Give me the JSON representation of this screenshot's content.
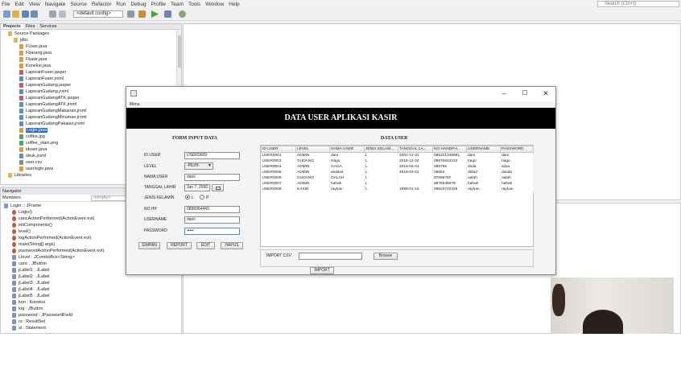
{
  "ide": {
    "menu": [
      "File",
      "Edit",
      "View",
      "Navigate",
      "Source",
      "Refactor",
      "Run",
      "Debug",
      "Profile",
      "Team",
      "Tools",
      "Window",
      "Help"
    ],
    "search_placeholder": "Search (Ctrl+I)",
    "config_select": "<default config>",
    "projects_tabs": [
      "Projects",
      "Files",
      "Services"
    ],
    "tree": [
      {
        "label": "Source Packages",
        "indent": 1
      },
      {
        "label": "jdbc",
        "indent": 2
      },
      {
        "label": "FUser.java",
        "indent": 3
      },
      {
        "label": "Fbarang.java",
        "indent": 3
      },
      {
        "label": "Fkasir.java",
        "indent": 3
      },
      {
        "label": "Koneksi.java",
        "indent": 3
      },
      {
        "label": "LaporanFuser.jasper",
        "indent": 3
      },
      {
        "label": "LaporanFuser.jrxml",
        "indent": 3
      },
      {
        "label": "LaporanGudang.jasper",
        "indent": 3
      },
      {
        "label": "LaporanGudang.jrxml",
        "indent": 3
      },
      {
        "label": "LaporanGudangATK.jasper",
        "indent": 3
      },
      {
        "label": "LaporanGudangATK.jrxml",
        "indent": 3
      },
      {
        "label": "LaporanGudangMakanan.jrxml",
        "indent": 3
      },
      {
        "label": "LaporanGudangMinuman.jrxml",
        "indent": 3
      },
      {
        "label": "LaporanGudangPakaian.jrxml",
        "indent": 3
      },
      {
        "label": "Login.java",
        "indent": 3,
        "selected": true
      },
      {
        "label": "coffee.jpg",
        "indent": 3
      },
      {
        "label": "coffee_stain.png",
        "indent": 3
      },
      {
        "label": "iduser.java",
        "indent": 3
      },
      {
        "label": "struk.jrxml",
        "indent": 3
      },
      {
        "label": "user.csv",
        "indent": 3
      },
      {
        "label": "userlogin.java",
        "indent": 3
      },
      {
        "label": "Libraries",
        "indent": 1
      }
    ],
    "navigator_tab": "Navigator",
    "members_label": "Members",
    "members_filter": "<empty>",
    "members": [
      "Login :: JFrame",
      "Login()",
      "cancActionPerformed(ActionEvent evt)",
      "initComponents()",
      "level()",
      "logActionPerformed(ActionEvent evt)",
      "main(String[] args)",
      "passwordActionPerformed(ActionEvent evt)",
      "Llevel : JComboBox<String>",
      "canc : JButton",
      "jLabel1 : JLabel",
      "jLabel2 : JLabel",
      "jLabel3 : JLabel",
      "jLabel4 : JLabel",
      "jLabel5 : JLabel",
      "kon : Koneksi",
      "log : JButton",
      "password : JPasswordField",
      "rs : ResultSet",
      "st : Statement"
    ]
  },
  "app": {
    "menu": "Menu",
    "banner": "DATA USER APLIKASI KASIR",
    "form_title": "FORM INPUT DATA",
    "table_title": "DATA USER",
    "labels": {
      "id_user": "ID USER",
      "level": "LEVEL",
      "nama_user": "NAMA USER",
      "tanggal_lahir": "TANGGAL LAHIR",
      "jenis_kelamin": "JENIS KELAMIN",
      "no_hp": "NO HP",
      "username": "USERNAME",
      "password": "PASSWORD",
      "radio_l": "L",
      "radio_p": "P",
      "import_csv": "IMPORT CSV"
    },
    "values": {
      "id_user": "USER0009",
      "level": "-PILIH-",
      "nama_user": "danii",
      "tanggal_lahir": "Jan 7, 2000",
      "no_hp": "0896964443",
      "username": "danii",
      "password": "•••••",
      "import_path": ""
    },
    "buttons": {
      "simpan": "SIMPAN",
      "report": "REPORT",
      "edit": "EDIT",
      "hapus": "HAPUS",
      "browse": "Browse",
      "import": "IMPORT"
    },
    "table": {
      "columns": [
        "ID USER",
        "LEVEL",
        "NAMA USER",
        "JENIS KELAM...",
        "TANGGAL LA...",
        "NO HANDPH...",
        "USERNAME",
        "PASSWORD"
      ],
      "rows": [
        [
          "USER0001",
          "ADMIN",
          "dani",
          "L",
          "2002-12-31",
          "085321349681",
          "dani",
          "dani"
        ],
        [
          "USER0002",
          "GUDANG",
          "Hago",
          "L",
          "2018-12-24",
          "09876543233",
          "hago",
          "hago"
        ],
        [
          "USER0004",
          "ADMIN",
          "GAGA",
          "L",
          "2019-03-01",
          "098765",
          "dsda",
          "sdsa"
        ],
        [
          "USER0005",
          "ADMIN",
          "asdasd",
          "L",
          "2019-03-01",
          "09564",
          "dsfad",
          "dasda"
        ],
        [
          "USER0006",
          "GUDANG",
          "OALAH",
          "L",
          "",
          "87656787",
          "oalah",
          "oalah"
        ],
        [
          "USER0007",
          "ADMIN",
          "hahah",
          "L",
          "",
          "9876545678",
          "hahah",
          "hahah"
        ],
        [
          "USER0008",
          "KASIR",
          "rayhan",
          "L",
          "1999-01-15",
          "08623722326",
          "rayhan",
          "rayhan"
        ]
      ]
    }
  }
}
